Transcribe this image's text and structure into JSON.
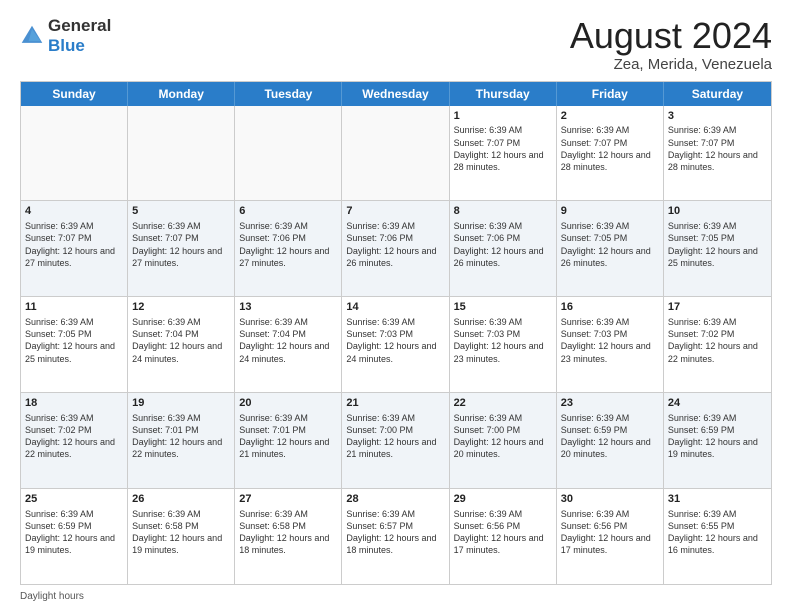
{
  "header": {
    "logo_line1": "General",
    "logo_line2": "Blue",
    "title": "August 2024",
    "subtitle": "Zea, Merida, Venezuela"
  },
  "calendar": {
    "days_of_week": [
      "Sunday",
      "Monday",
      "Tuesday",
      "Wednesday",
      "Thursday",
      "Friday",
      "Saturday"
    ],
    "weeks": [
      [
        {
          "day": "",
          "info": "",
          "alt": false,
          "empty": true
        },
        {
          "day": "",
          "info": "",
          "alt": false,
          "empty": true
        },
        {
          "day": "",
          "info": "",
          "alt": false,
          "empty": true
        },
        {
          "day": "",
          "info": "",
          "alt": false,
          "empty": true
        },
        {
          "day": "1",
          "info": "Sunrise: 6:39 AM\nSunset: 7:07 PM\nDaylight: 12 hours and 28 minutes.",
          "alt": false,
          "empty": false
        },
        {
          "day": "2",
          "info": "Sunrise: 6:39 AM\nSunset: 7:07 PM\nDaylight: 12 hours and 28 minutes.",
          "alt": false,
          "empty": false
        },
        {
          "day": "3",
          "info": "Sunrise: 6:39 AM\nSunset: 7:07 PM\nDaylight: 12 hours and 28 minutes.",
          "alt": false,
          "empty": false
        }
      ],
      [
        {
          "day": "4",
          "info": "Sunrise: 6:39 AM\nSunset: 7:07 PM\nDaylight: 12 hours and 27 minutes.",
          "alt": true,
          "empty": false
        },
        {
          "day": "5",
          "info": "Sunrise: 6:39 AM\nSunset: 7:07 PM\nDaylight: 12 hours and 27 minutes.",
          "alt": true,
          "empty": false
        },
        {
          "day": "6",
          "info": "Sunrise: 6:39 AM\nSunset: 7:06 PM\nDaylight: 12 hours and 27 minutes.",
          "alt": true,
          "empty": false
        },
        {
          "day": "7",
          "info": "Sunrise: 6:39 AM\nSunset: 7:06 PM\nDaylight: 12 hours and 26 minutes.",
          "alt": true,
          "empty": false
        },
        {
          "day": "8",
          "info": "Sunrise: 6:39 AM\nSunset: 7:06 PM\nDaylight: 12 hours and 26 minutes.",
          "alt": true,
          "empty": false
        },
        {
          "day": "9",
          "info": "Sunrise: 6:39 AM\nSunset: 7:05 PM\nDaylight: 12 hours and 26 minutes.",
          "alt": true,
          "empty": false
        },
        {
          "day": "10",
          "info": "Sunrise: 6:39 AM\nSunset: 7:05 PM\nDaylight: 12 hours and 25 minutes.",
          "alt": true,
          "empty": false
        }
      ],
      [
        {
          "day": "11",
          "info": "Sunrise: 6:39 AM\nSunset: 7:05 PM\nDaylight: 12 hours and 25 minutes.",
          "alt": false,
          "empty": false
        },
        {
          "day": "12",
          "info": "Sunrise: 6:39 AM\nSunset: 7:04 PM\nDaylight: 12 hours and 24 minutes.",
          "alt": false,
          "empty": false
        },
        {
          "day": "13",
          "info": "Sunrise: 6:39 AM\nSunset: 7:04 PM\nDaylight: 12 hours and 24 minutes.",
          "alt": false,
          "empty": false
        },
        {
          "day": "14",
          "info": "Sunrise: 6:39 AM\nSunset: 7:03 PM\nDaylight: 12 hours and 24 minutes.",
          "alt": false,
          "empty": false
        },
        {
          "day": "15",
          "info": "Sunrise: 6:39 AM\nSunset: 7:03 PM\nDaylight: 12 hours and 23 minutes.",
          "alt": false,
          "empty": false
        },
        {
          "day": "16",
          "info": "Sunrise: 6:39 AM\nSunset: 7:03 PM\nDaylight: 12 hours and 23 minutes.",
          "alt": false,
          "empty": false
        },
        {
          "day": "17",
          "info": "Sunrise: 6:39 AM\nSunset: 7:02 PM\nDaylight: 12 hours and 22 minutes.",
          "alt": false,
          "empty": false
        }
      ],
      [
        {
          "day": "18",
          "info": "Sunrise: 6:39 AM\nSunset: 7:02 PM\nDaylight: 12 hours and 22 minutes.",
          "alt": true,
          "empty": false
        },
        {
          "day": "19",
          "info": "Sunrise: 6:39 AM\nSunset: 7:01 PM\nDaylight: 12 hours and 22 minutes.",
          "alt": true,
          "empty": false
        },
        {
          "day": "20",
          "info": "Sunrise: 6:39 AM\nSunset: 7:01 PM\nDaylight: 12 hours and 21 minutes.",
          "alt": true,
          "empty": false
        },
        {
          "day": "21",
          "info": "Sunrise: 6:39 AM\nSunset: 7:00 PM\nDaylight: 12 hours and 21 minutes.",
          "alt": true,
          "empty": false
        },
        {
          "day": "22",
          "info": "Sunrise: 6:39 AM\nSunset: 7:00 PM\nDaylight: 12 hours and 20 minutes.",
          "alt": true,
          "empty": false
        },
        {
          "day": "23",
          "info": "Sunrise: 6:39 AM\nSunset: 6:59 PM\nDaylight: 12 hours and 20 minutes.",
          "alt": true,
          "empty": false
        },
        {
          "day": "24",
          "info": "Sunrise: 6:39 AM\nSunset: 6:59 PM\nDaylight: 12 hours and 19 minutes.",
          "alt": true,
          "empty": false
        }
      ],
      [
        {
          "day": "25",
          "info": "Sunrise: 6:39 AM\nSunset: 6:59 PM\nDaylight: 12 hours and 19 minutes.",
          "alt": false,
          "empty": false
        },
        {
          "day": "26",
          "info": "Sunrise: 6:39 AM\nSunset: 6:58 PM\nDaylight: 12 hours and 19 minutes.",
          "alt": false,
          "empty": false
        },
        {
          "day": "27",
          "info": "Sunrise: 6:39 AM\nSunset: 6:58 PM\nDaylight: 12 hours and 18 minutes.",
          "alt": false,
          "empty": false
        },
        {
          "day": "28",
          "info": "Sunrise: 6:39 AM\nSunset: 6:57 PM\nDaylight: 12 hours and 18 minutes.",
          "alt": false,
          "empty": false
        },
        {
          "day": "29",
          "info": "Sunrise: 6:39 AM\nSunset: 6:56 PM\nDaylight: 12 hours and 17 minutes.",
          "alt": false,
          "empty": false
        },
        {
          "day": "30",
          "info": "Sunrise: 6:39 AM\nSunset: 6:56 PM\nDaylight: 12 hours and 17 minutes.",
          "alt": false,
          "empty": false
        },
        {
          "day": "31",
          "info": "Sunrise: 6:39 AM\nSunset: 6:55 PM\nDaylight: 12 hours and 16 minutes.",
          "alt": false,
          "empty": false
        }
      ]
    ]
  },
  "footer": {
    "daylight_label": "Daylight hours"
  }
}
